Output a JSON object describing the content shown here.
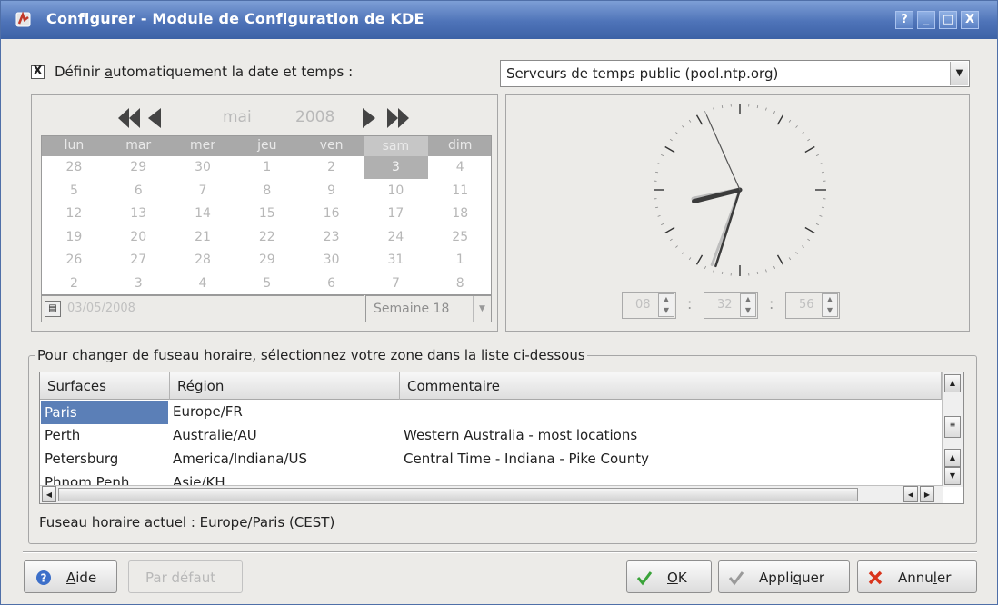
{
  "window": {
    "title": "Configurer - Module de Configuration de KDE",
    "controls": {
      "help": "?",
      "minimize": "_",
      "maximize": "□",
      "close": "X"
    }
  },
  "auto": {
    "checkbox": "X",
    "label_pre": "Définir ",
    "label_key": "a",
    "label_post": "utomatiquement la date et temps :",
    "server": "Serveurs de temps public (pool.ntp.org)"
  },
  "calendar": {
    "month": "mai",
    "year": "2008",
    "days": [
      "lun",
      "mar",
      "mer",
      "jeu",
      "ven",
      "sam",
      "dim"
    ],
    "weeks": [
      [
        "28",
        "29",
        "30",
        "1",
        "2",
        "3",
        "4"
      ],
      [
        "5",
        "6",
        "7",
        "8",
        "9",
        "10",
        "11"
      ],
      [
        "12",
        "13",
        "14",
        "15",
        "16",
        "17",
        "18"
      ],
      [
        "19",
        "20",
        "21",
        "22",
        "23",
        "24",
        "25"
      ],
      [
        "26",
        "27",
        "28",
        "29",
        "30",
        "31",
        "1"
      ],
      [
        "2",
        "3",
        "4",
        "5",
        "6",
        "7",
        "8"
      ]
    ],
    "date": "03/05/2008",
    "week": "Semaine 18"
  },
  "clock": {
    "hours": "08",
    "minutes": "32",
    "seconds": "56",
    "sep": ":"
  },
  "timezone": {
    "legend": "Pour changer de fuseau horaire, sélectionnez votre zone dans la liste ci-dessous",
    "columns": [
      "Surfaces",
      "Région",
      "Commentaire"
    ],
    "rows": [
      {
        "surface": "Paris",
        "region": "Europe/FR",
        "comment": ""
      },
      {
        "surface": "Perth",
        "region": "Australie/AU",
        "comment": "Western Australia - most locations"
      },
      {
        "surface": "Petersburg",
        "region": "America/Indiana/US",
        "comment": "Central Time - Indiana - Pike County"
      },
      {
        "surface": "Phnom Penh",
        "region": "Asie/KH",
        "comment": ""
      }
    ],
    "current": "Fuseau horaire actuel : Europe/Paris (CEST)"
  },
  "buttons": {
    "help_key": "A",
    "help_rest": "ide",
    "default": "Par défaut",
    "ok_key": "O",
    "ok_rest": "K",
    "apply_pre": "Appli",
    "apply_key": "q",
    "apply_post": "uer",
    "cancel_pre": "Annu",
    "cancel_key": "l",
    "cancel_post": "er"
  },
  "colors": {
    "titlebar": "#4e73b8",
    "selection": "#5b7fb7"
  }
}
